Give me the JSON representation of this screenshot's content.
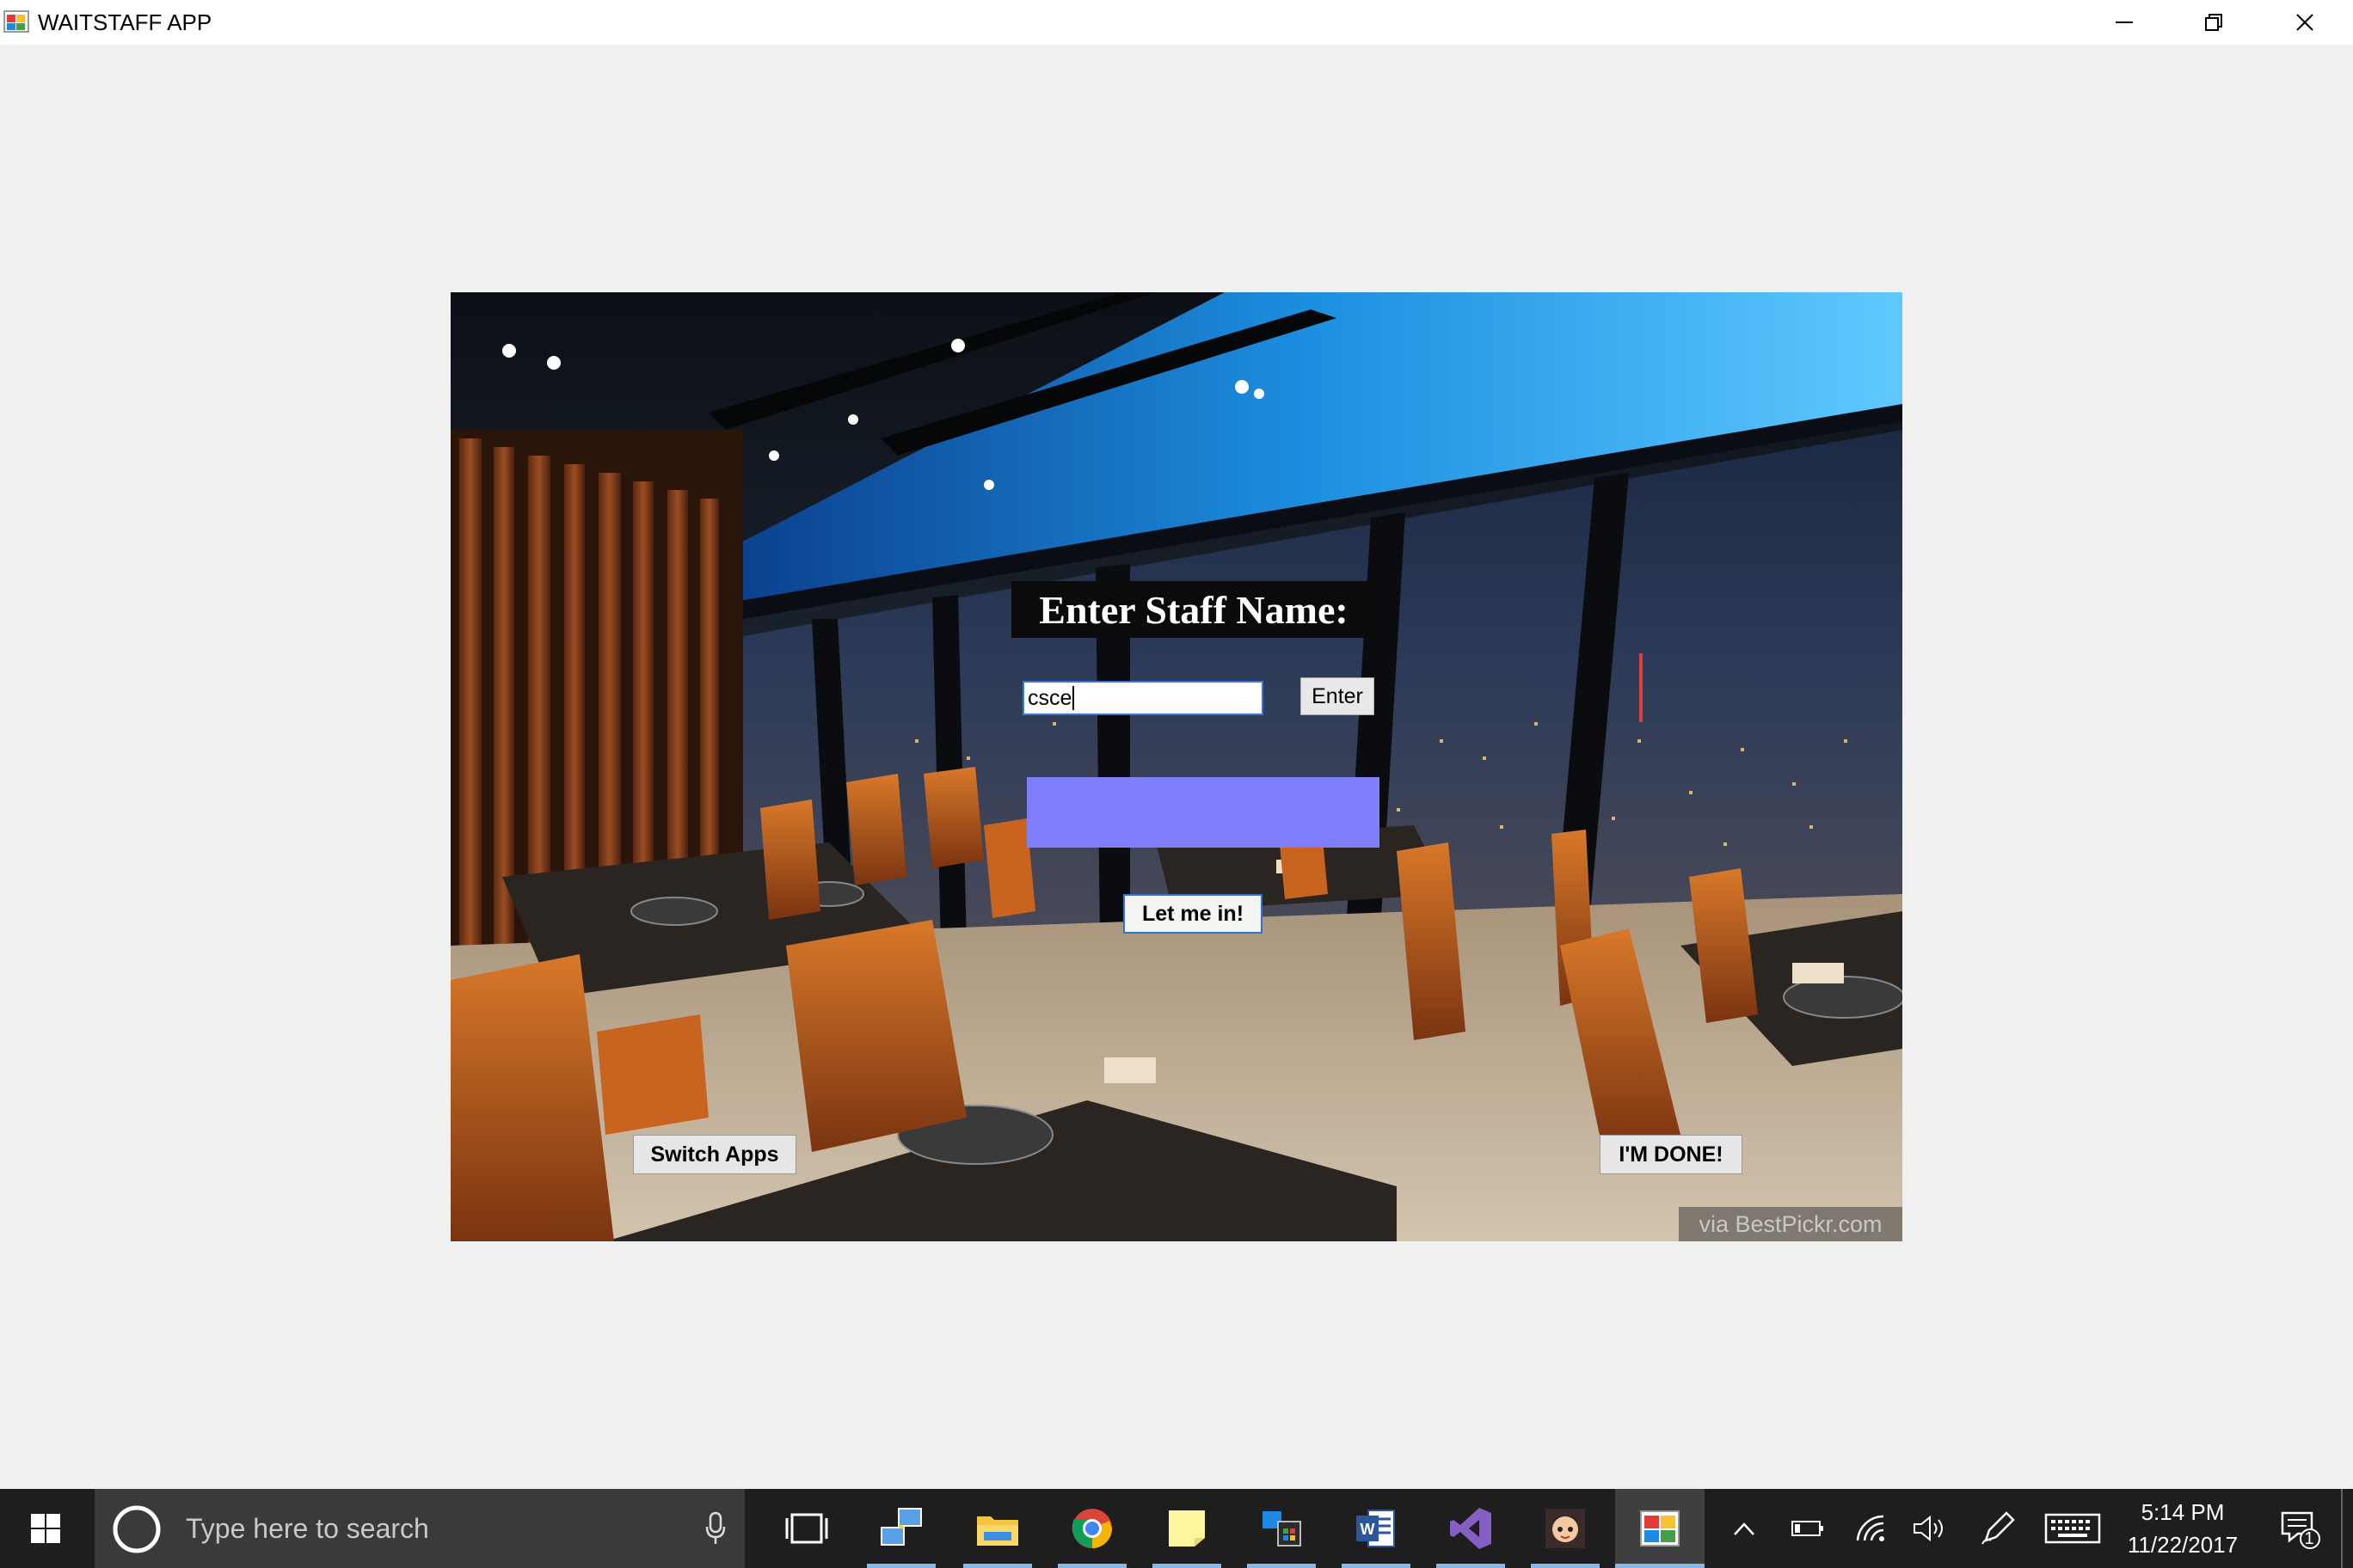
{
  "window": {
    "title": "WAITSTAFF APP",
    "controls": [
      "minimize",
      "restore",
      "close"
    ]
  },
  "login": {
    "prompt_label": "Enter Staff Name:",
    "name_input_value": "csce",
    "enter_button": "Enter",
    "status_box_color": "#7f7ffc",
    "let_me_in_button": "Let me in!",
    "switch_apps_button": "Switch Apps",
    "done_button": "I'M DONE!",
    "watermark": "via BestPickr.com"
  },
  "taskbar": {
    "search_placeholder": "Type here to search",
    "pinned": [
      "task-view-icon",
      "network-app-icon",
      "file-explorer-icon",
      "chrome-icon",
      "sticky-notes-icon",
      "store-icon",
      "word-icon",
      "visual-studio-icon",
      "game-icon",
      "waitstaff-app-icon"
    ],
    "tray": [
      "chevron-up-icon",
      "battery-icon",
      "wifi-icon",
      "volume-icon",
      "pen-icon",
      "keyboard-icon"
    ],
    "time": "5:14 PM",
    "date": "11/22/2017",
    "notification_count": "1"
  }
}
